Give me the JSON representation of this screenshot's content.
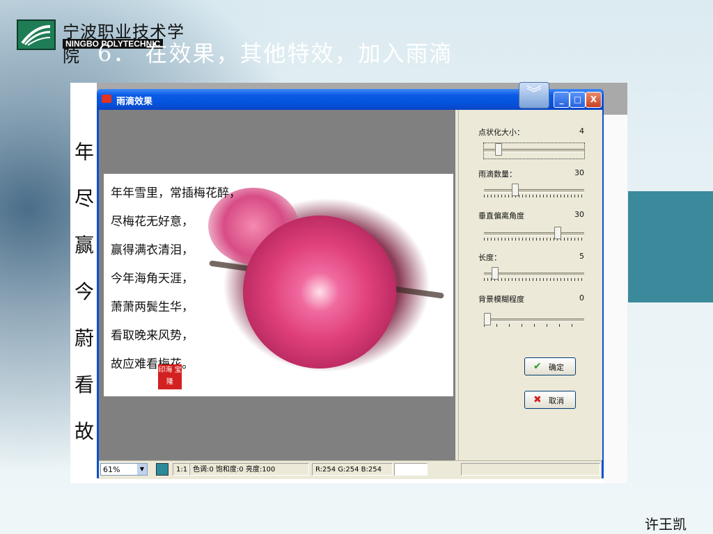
{
  "slide": {
    "logo_cn": "宁波职业技术学院",
    "logo_en": "NINGBO POLYTECHNIC",
    "title": "6．  在效果，其他特效，加入雨滴",
    "author": "许王凯"
  },
  "side_text": [
    "年",
    "尽",
    "赢",
    "今",
    "蔚",
    "看",
    "故"
  ],
  "window": {
    "title": "雨滴效果",
    "minimize": "_",
    "maximize": "□",
    "close": "X"
  },
  "poem": {
    "lines": [
      "年年雪里，常插梅花醉，",
      "尽梅花无好意，",
      "赢得满衣清泪，",
      "今年海角天涯，",
      "萧萧两鬓生华，",
      "看取晚来风势，",
      "故应难看梅花。"
    ],
    "seal": "印海 宝隆"
  },
  "controls": [
    {
      "label": "点状化大小：",
      "value": "4",
      "level": 0.12
    },
    {
      "label": "雨滴数量：",
      "value": "30",
      "level": 0.3
    },
    {
      "label": "垂直偏离角度",
      "value": "30",
      "level": 0.75
    },
    {
      "label": "长度：",
      "value": "5",
      "level": 0.08
    },
    {
      "label": "背景模糊程度",
      "value": "0",
      "level": 0.0
    }
  ],
  "buttons": {
    "ok": "确定",
    "cancel": "取消"
  },
  "status": {
    "zoom": "61%",
    "ratio": "1:1",
    "adjust": "色调:0 饱和度:0 亮度:100",
    "rgb": "R:254 G:254 B:254"
  }
}
